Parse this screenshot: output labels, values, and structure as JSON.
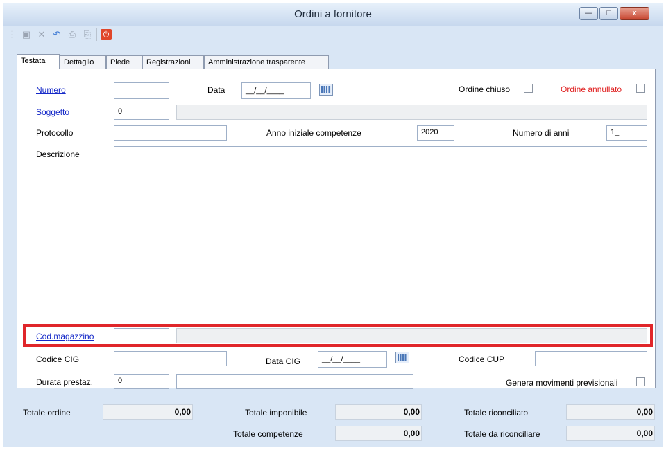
{
  "window": {
    "title": "Ordini a fornitore",
    "minimize_glyph": "—",
    "maximize_glyph": "□",
    "close_glyph": "x"
  },
  "toolbar": {
    "icons": [
      "save-icon",
      "delete-icon",
      "undo-icon",
      "print-icon",
      "print-preview-icon",
      "exit-icon"
    ]
  },
  "tabs": [
    "Testata",
    "Dettaglio",
    "Piede",
    "Registrazioni",
    "Amministrazione trasparente"
  ],
  "form": {
    "numero_label": "Numero",
    "numero_value": "",
    "data_label": "Data",
    "data_value": "__/__/____",
    "ordine_chiuso_label": "Ordine chiuso",
    "ordine_annullato_label": "Ordine annullato",
    "soggetto_label": "Soggetto",
    "soggetto_value": "0",
    "protocollo_label": "Protocollo",
    "anno_iniziale_label": "Anno iniziale competenze",
    "anno_iniziale_value": "2020",
    "numero_anni_label": "Numero di anni",
    "numero_anni_value": "1_",
    "descrizione_label": "Descrizione",
    "cod_magazzino_label": "Cod.magazzino",
    "codice_cig_label": "Codice CIG",
    "data_cig_label": "Data CIG",
    "data_cig_value": "__/__/____",
    "codice_cup_label": "Codice CUP",
    "durata_label": "Durata prestaz.",
    "durata_value": "0",
    "genera_label": "Genera movimenti previsionali"
  },
  "totals": {
    "totale_ordine_label": "Totale ordine",
    "totale_ordine_value": "0,00",
    "totale_imponibile_label": "Totale imponibile",
    "totale_imponibile_value": "0,00",
    "totale_riconciliato_label": "Totale riconciliato",
    "totale_riconciliato_value": "0,00",
    "totale_competenze_label": "Totale competenze",
    "totale_competenze_value": "0,00",
    "totale_da_riconciliare_label": "Totale da riconciliare",
    "totale_da_riconciliare_value": "0,00"
  },
  "colors": {
    "link": "#1428c8",
    "highlight": "#e0262a",
    "annullato": "#e02020"
  }
}
